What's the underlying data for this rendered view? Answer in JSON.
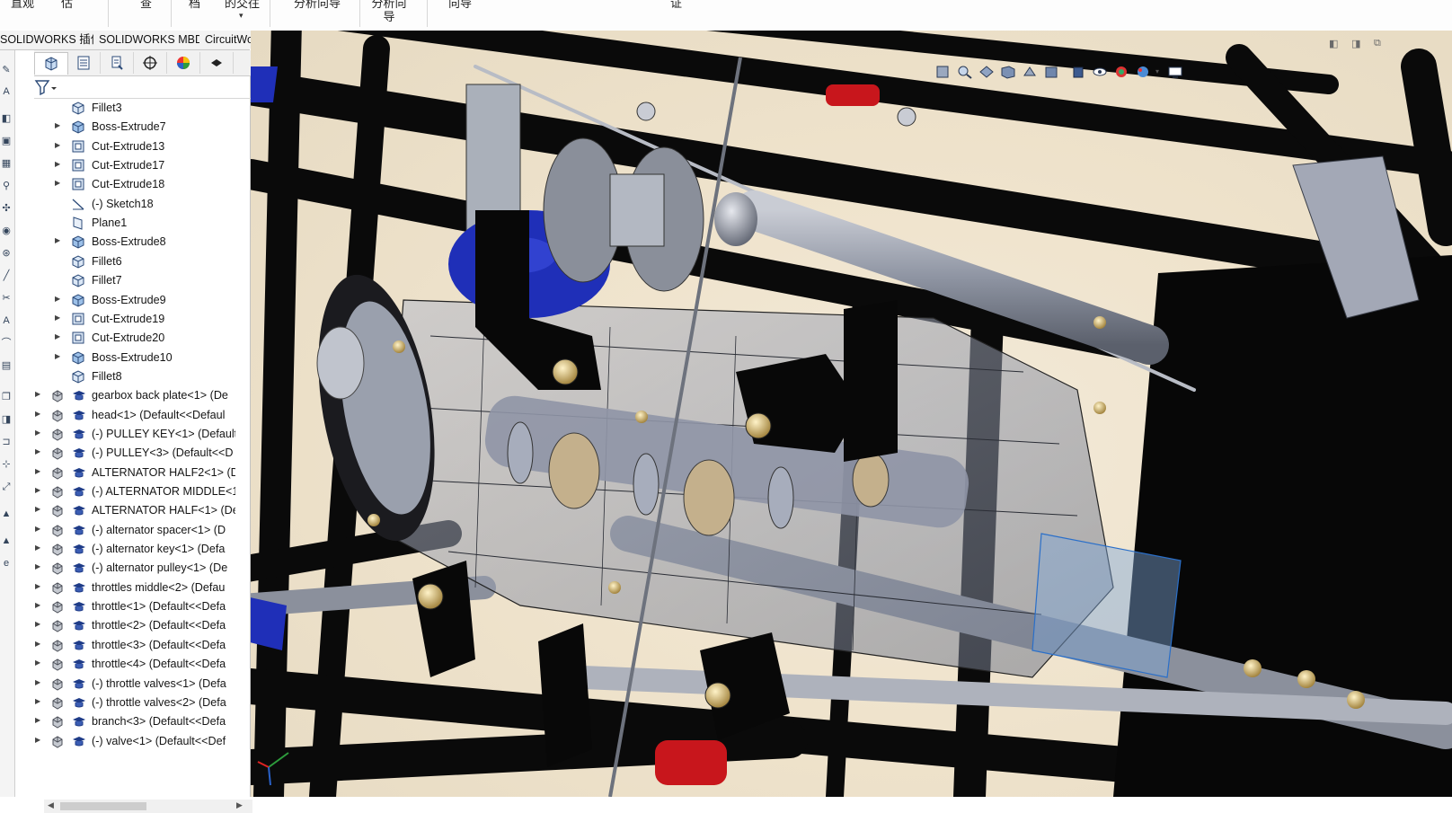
{
  "ribbon": {
    "items": [
      "直观",
      "估",
      "查",
      "档",
      "的交往",
      "分析向导",
      "分析向导",
      "向导",
      "证"
    ]
  },
  "tabs": [
    "SOLIDWORKS 插件",
    "SOLIDWORKS MBD",
    "CircuitWorks"
  ],
  "feature_tree": {
    "features": [
      {
        "label": "Fillet3",
        "expandable": false,
        "icon": "fillet-icon"
      },
      {
        "label": "Boss-Extrude7",
        "expandable": true,
        "icon": "boss-extrude-icon"
      },
      {
        "label": "Cut-Extrude13",
        "expandable": true,
        "icon": "cut-extrude-icon"
      },
      {
        "label": "Cut-Extrude17",
        "expandable": true,
        "icon": "cut-extrude-icon"
      },
      {
        "label": "Cut-Extrude18",
        "expandable": true,
        "icon": "cut-extrude-icon"
      },
      {
        "label": "(-) Sketch18",
        "expandable": false,
        "icon": "sketch-icon"
      },
      {
        "label": "Plane1",
        "expandable": false,
        "icon": "plane-icon"
      },
      {
        "label": "Boss-Extrude8",
        "expandable": true,
        "icon": "boss-extrude-icon"
      },
      {
        "label": "Fillet6",
        "expandable": false,
        "icon": "fillet-icon"
      },
      {
        "label": "Fillet7",
        "expandable": false,
        "icon": "fillet-icon"
      },
      {
        "label": "Boss-Extrude9",
        "expandable": true,
        "icon": "boss-extrude-icon"
      },
      {
        "label": "Cut-Extrude19",
        "expandable": true,
        "icon": "cut-extrude-icon"
      },
      {
        "label": "Cut-Extrude20",
        "expandable": true,
        "icon": "cut-extrude-icon"
      },
      {
        "label": "Boss-Extrude10",
        "expandable": true,
        "icon": "boss-extrude-icon"
      },
      {
        "label": "Fillet8",
        "expandable": false,
        "icon": "fillet-icon"
      }
    ],
    "components": [
      "gearbox back plate<1> (De",
      "head<1> (Default<<Defaul",
      "(-) PULLEY KEY<1> (Default",
      "(-) PULLEY<3> (Default<<D",
      "ALTERNATOR HALF2<1> (D",
      "(-) ALTERNATOR MIDDLE<1",
      "ALTERNATOR HALF<1> (De",
      "(-) alternator spacer<1> (D",
      "(-) alternator key<1> (Defa",
      "(-) alternator pulley<1> (De",
      "throttles middle<2> (Defau",
      "throttle<1> (Default<<Defa",
      "throttle<2> (Default<<Defa",
      "throttle<3> (Default<<Defa",
      "throttle<4> (Default<<Defa",
      "(-) throttle valves<1> (Defa",
      "(-) throttle valves<2> (Defa",
      "branch<3> (Default<<Defa",
      "(-) valve<1> (Default<<Def"
    ]
  },
  "colors": {
    "frame": "#111111",
    "part_gray": "#9aa0ad",
    "accent_blue": "#1f2fb8",
    "accent_red": "#c8161c",
    "brass": "#c9a45a",
    "background": "#efe3cc"
  }
}
